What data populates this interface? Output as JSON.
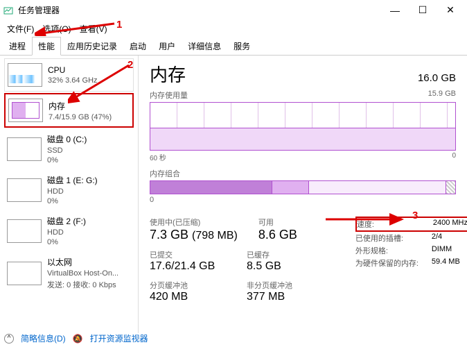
{
  "window": {
    "title": "任务管理器"
  },
  "menu": [
    "文件(F)",
    "选项(O)",
    "查看(V)"
  ],
  "tabs": [
    "进程",
    "性能",
    "应用历史记录",
    "启动",
    "用户",
    "详细信息",
    "服务"
  ],
  "sidebar": [
    {
      "name": "CPU",
      "val": "32% 3.64 GHz"
    },
    {
      "name": "内存",
      "val": "7.4/15.9 GB (47%)"
    },
    {
      "name": "磁盘 0 (C:)",
      "val": "SSD",
      "val2": "0%"
    },
    {
      "name": "磁盘 1 (E: G:)",
      "val": "HDD",
      "val2": "0%"
    },
    {
      "name": "磁盘 2 (F:)",
      "val": "HDD",
      "val2": "0%"
    },
    {
      "name": "以太网",
      "val": "VirtualBox Host-On...",
      "val2": "发送: 0 接收: 0 Kbps"
    }
  ],
  "title": "内存",
  "total": "16.0 GB",
  "usageLabel": "内存使用量",
  "usageMax": "15.9 GB",
  "axis60": "60 秒",
  "axis0": "0",
  "compLabel": "内存组合",
  "stats": {
    "usedLbl": "使用中(已压缩)",
    "used": "7.3 GB",
    "usedSub": "(798 MB)",
    "availLbl": "可用",
    "avail": "8.6 GB",
    "commitLbl": "已提交",
    "commit": "17.6/21.4 GB",
    "cachedLbl": "已缓存",
    "cached": "8.5 GB",
    "pagedLbl": "分页缓冲池",
    "paged": "420 MB",
    "nonpagedLbl": "非分页缓冲池",
    "nonpaged": "377 MB"
  },
  "kv": {
    "speedK": "速度:",
    "speedV": "2400 MHz",
    "slotsK": "已使用的插槽:",
    "slotsV": "2/4",
    "formK": "外形规格:",
    "formV": "DIMM",
    "hwK": "为硬件保留的内存:",
    "hwV": "59.4 MB"
  },
  "footer": {
    "brief": "简略信息(D)",
    "link": "打开资源监视器"
  },
  "annot": {
    "a1": "1",
    "a2": "2",
    "a3": "3"
  }
}
